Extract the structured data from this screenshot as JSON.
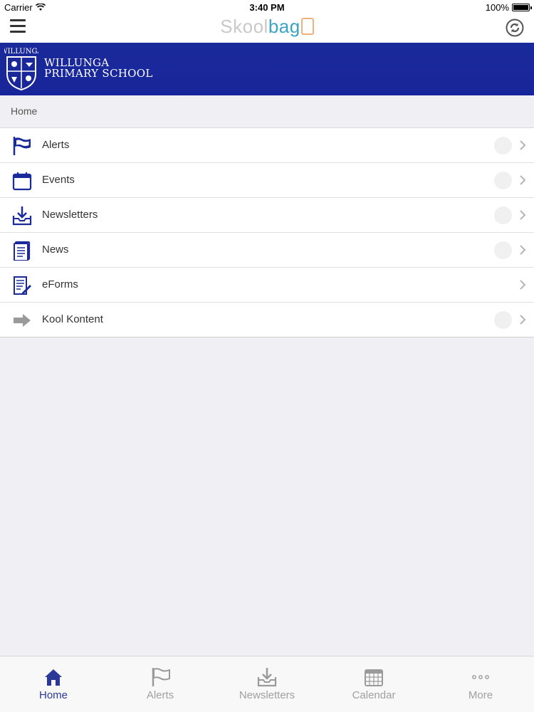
{
  "status_bar": {
    "carrier": "Carrier",
    "time": "3:40 PM",
    "battery": "100%"
  },
  "navbar": {
    "logo_part1": "Skool",
    "logo_part2": "bag",
    "menu_icon": "hamburger-icon",
    "sync_icon": "sync-icon"
  },
  "banner": {
    "crest_text": "WILLUNGA",
    "school_line1": "WILLUNGA",
    "school_line2": "PRIMARY SCHOOL",
    "color": "#1b2a9a"
  },
  "breadcrumb": "Home",
  "menu": [
    {
      "label": "Alerts",
      "icon": "flag-icon",
      "badge": true
    },
    {
      "label": "Events",
      "icon": "calendar-icon",
      "badge": true
    },
    {
      "label": "Newsletters",
      "icon": "inbox-download-icon",
      "badge": true
    },
    {
      "label": "News",
      "icon": "document-icon",
      "badge": true
    },
    {
      "label": "eForms",
      "icon": "form-pen-icon",
      "badge": false
    },
    {
      "label": "Kool Kontent",
      "icon": "arrow-right-icon",
      "badge": true
    }
  ],
  "tabs": [
    {
      "label": "Home",
      "icon": "home-icon",
      "active": true
    },
    {
      "label": "Alerts",
      "icon": "flag-icon",
      "active": false
    },
    {
      "label": "Newsletters",
      "icon": "inbox-download-icon",
      "active": false
    },
    {
      "label": "Calendar",
      "icon": "calendar-grid-icon",
      "active": false
    },
    {
      "label": "More",
      "icon": "more-dots-icon",
      "active": false
    }
  ],
  "colors": {
    "accent": "#2b3896",
    "banner": "#1b2a9a",
    "inactive": "#a0a0a0"
  }
}
